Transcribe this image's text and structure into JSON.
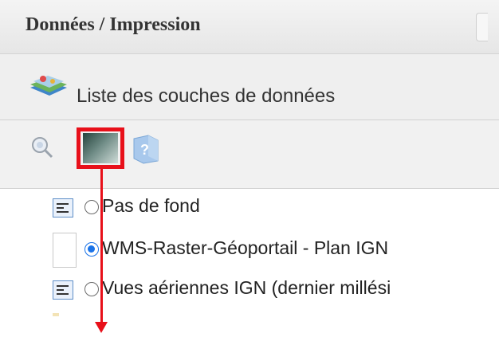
{
  "panel": {
    "title": "Données / Impression"
  },
  "section": {
    "title": "Liste des couches de données",
    "icon": "layers-icon"
  },
  "toolbar": {
    "tools": [
      {
        "name": "zoom",
        "icon": "zoom-icon"
      },
      {
        "name": "background",
        "icon": "background-swatch-icon",
        "highlighted": true
      },
      {
        "name": "help",
        "icon": "help-icon"
      }
    ]
  },
  "layers": [
    {
      "label": "Pas de fond",
      "selected": false,
      "legend": "legend-icon"
    },
    {
      "label": "WMS-Raster-Géoportail - Plan IGN",
      "selected": true,
      "legend": "blank"
    },
    {
      "label": "Vues aériennes IGN (dernier millési",
      "selected": false,
      "legend": "legend-icon"
    }
  ],
  "colors": {
    "highlight": "#e8101a",
    "radio_selected": "#1a73e8",
    "header_bg": "#efefef"
  }
}
